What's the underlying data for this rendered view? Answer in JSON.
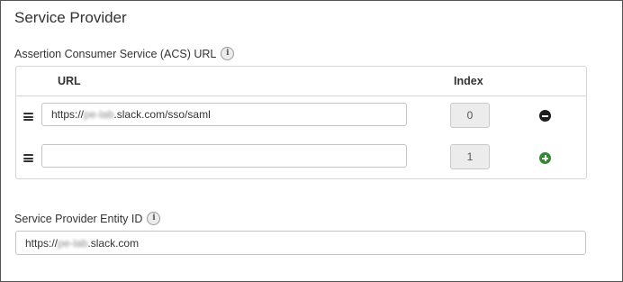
{
  "section": {
    "title": "Service Provider"
  },
  "acs": {
    "label": "Assertion Consumer Service (ACS) URL",
    "info_icon": "info-icon",
    "columns": {
      "url": "URL",
      "index": "Index"
    },
    "rows": [
      {
        "url_prefix": "https://",
        "url_redacted": "pe-lab",
        "url_suffix": ".slack.com/sso/saml",
        "index": "0",
        "action": "remove"
      },
      {
        "url_prefix": "",
        "url_redacted": "",
        "url_suffix": "",
        "index": "1",
        "action": "add"
      }
    ]
  },
  "entity": {
    "label": "Service Provider Entity ID",
    "info_icon": "info-icon",
    "value_prefix": "https://",
    "value_redacted": "pe-lab",
    "value_suffix": ".slack.com"
  },
  "colors": {
    "add": "#2e8b2e",
    "remove": "#1e1e1e",
    "border": "#555555"
  }
}
